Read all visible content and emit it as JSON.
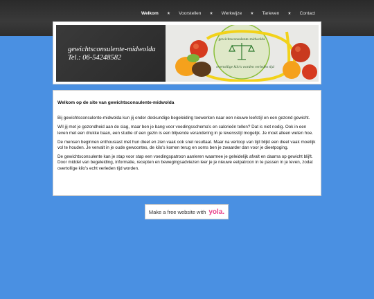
{
  "nav": {
    "items": [
      {
        "label": "Welkom",
        "active": true
      },
      {
        "label": "Voorstellen",
        "active": false
      },
      {
        "label": "Werkwijze",
        "active": false
      },
      {
        "label": "Tarieven",
        "active": false
      },
      {
        "label": "Contact",
        "active": false
      }
    ],
    "separator": "★"
  },
  "header": {
    "site_title": "gewichtsconsulente-midwolda",
    "phone": "Tel.: 06-54248582",
    "image_text_top": "gewichtsconsulente-midwolda",
    "image_text_bottom": "overtollige kilo's worden verleden tijd",
    "image_icon": "scales-icon"
  },
  "content": {
    "heading": "Welkom op de site van gewichtsconsulente-midwolda",
    "paragraphs": [
      "Bij gewichtsconsulente-midwolda kun jij onder deskundige begeleiding toewerken naar een nieuwe leefstijl en een gezond gewicht.",
      "Wil jij met je gezondheid aan de slag, maar ben je bang voor voedingsschema's en calorieën tellen? Dat is niet nodig. Ook in een leven met een drukke baan, een studie of een gezin is een blijvende verandering in je levensstijl mogelijk. Je moet alleen weten hoe.",
      "De mensen beginnen enthousiast met hun dieet en zien vaak ook snel resultaat. Maar na verloop van tijd blijkt een dieet vaak moeilijk vol te houden. Je vervalt in je oude gewoontes, de kilo's komen terug en soms ben je zwaarder dan voor je dieetpoging.",
      "De gewichtsconsulente kan je stap voor stap een voedingspatroon aanleren waarmee je geleidelijk afvalt en daarna op gewicht blijft. Door middel van begeleiding, informatie, recepten en bewegingsadviezen leer je je nieuwe eetpatroon in te passen in je leven, zodat overtollige kilo's echt verleden tijd worden."
    ]
  },
  "footer": {
    "badge_text": "Make a free website with",
    "badge_logo": "yola."
  },
  "colors": {
    "background": "#4a90e2",
    "topbar": "#2e2e2e",
    "yola_logo": "#e8418a"
  }
}
